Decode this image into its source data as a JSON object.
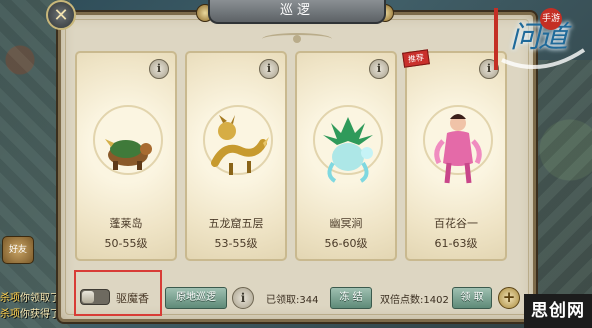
{
  "window": {
    "title": "巡逻",
    "close_glyph": "✕"
  },
  "logo": {
    "text": "问道",
    "seal": "手游"
  },
  "chat": [
    {
      "who": "杀项",
      "text": "你领取了"
    },
    {
      "who": "杀项",
      "text": "你获得了"
    }
  ],
  "side_button": {
    "label": "好友"
  },
  "cards": [
    {
      "name": "蓬莱岛",
      "level": "50-55级",
      "info": "i",
      "badge": "",
      "creature": "turtle-beast-icon"
    },
    {
      "name": "五龙窟五层",
      "level": "53-55级",
      "info": "i",
      "badge": "",
      "creature": "golden-dragon-icon"
    },
    {
      "name": "幽冥涧",
      "level": "56-60级",
      "info": "i",
      "badge": "",
      "creature": "green-spirit-icon"
    },
    {
      "name": "百花谷一",
      "level": "61-63级",
      "info": "i",
      "badge": "推荐",
      "creature": "flower-fairy-icon"
    }
  ],
  "bottom": {
    "toggle_label": "驱魔香",
    "toggle_on": false,
    "patrol_here_button": "原地巡逻",
    "info": "i",
    "claimed_label": "已领取:344",
    "freeze_button": "冻 结",
    "double_points_label": "双倍点数:1402",
    "claim_button": "领 取",
    "plus": "+"
  },
  "watermark": "思创网",
  "colors": {
    "highlight_box": "#d83c36",
    "green_button": "#5e8a78",
    "panel_bg": "#ddd6c2"
  }
}
